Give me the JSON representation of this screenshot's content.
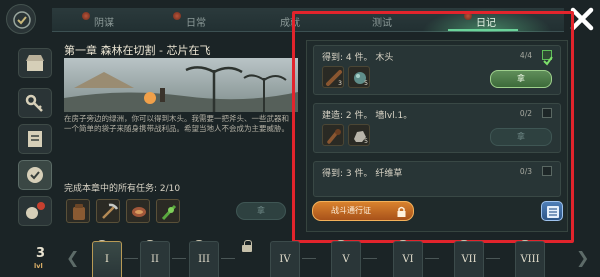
{
  "tabs": [
    {
      "label": "阴谋"
    },
    {
      "label": "日常"
    },
    {
      "label": "成就"
    },
    {
      "label": "测试"
    },
    {
      "label": "日记",
      "active": true
    }
  ],
  "chapter": {
    "title": "第一章 森林在切割 - 芯片在飞",
    "description": "在房子旁边的绿洲，你可以得到木头。我需要一把斧头、一些武器和一个简单的袋子来随身携带战利品。希望当地人不会成为主要威胁。",
    "tasks_label": "完成本章中的所有任务:",
    "tasks_progress": "2/10",
    "claim_label": "拿"
  },
  "task_list": [
    {
      "label": "得到: 4 件。 木头",
      "count": "4/4",
      "done": true,
      "items": [
        {
          "icon": "wood-icon",
          "qty": "3"
        },
        {
          "icon": "ore-icon",
          "qty": "5"
        }
      ],
      "claim_label": "拿",
      "claim_enabled": true
    },
    {
      "label": "建造: 2 件。 墙lvl.1。",
      "count": "0/2",
      "done": false,
      "items": [
        {
          "icon": "club-icon",
          "qty": ""
        },
        {
          "icon": "stone-icon",
          "qty": "5"
        }
      ],
      "claim_label": "拿",
      "claim_enabled": false
    },
    {
      "label": "得到: 3 件。 纤维草",
      "count": "0/3",
      "done": false,
      "items": [],
      "claim_label": "",
      "claim_enabled": false
    }
  ],
  "battle_pass_label": "战斗通行证",
  "level": {
    "number": "3",
    "tag": "lvl"
  },
  "chapter_tabs": [
    "I",
    "II",
    "III",
    "IV",
    "V",
    "VI",
    "VII",
    "VIII"
  ],
  "colors": {
    "highlight": "#e2242c",
    "accent_green": "#6bd39a",
    "battle_orange": "#d9822e"
  }
}
